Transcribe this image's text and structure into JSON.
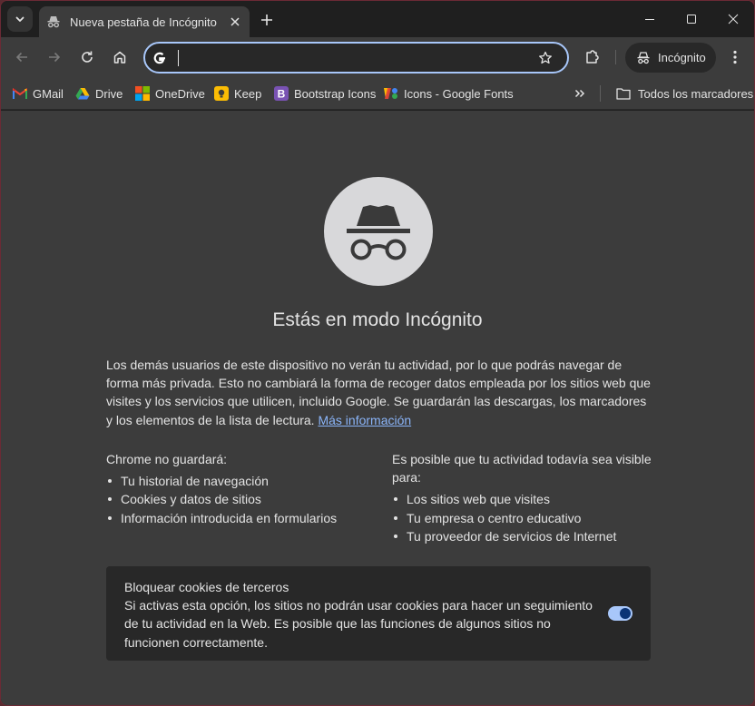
{
  "tabs": [
    {
      "title": "Nueva pestaña de Incógnito",
      "icon": "incognito-icon",
      "active": true
    }
  ],
  "toolbar": {
    "omnibox": {
      "value": "",
      "placeholder": "",
      "icon": "google-g-icon"
    },
    "incognito_chip_label": "Incógnito"
  },
  "bookmarks": {
    "items": [
      {
        "label": "GMail",
        "icon": "gmail-icon"
      },
      {
        "label": "Drive",
        "icon": "google-drive-icon"
      },
      {
        "label": "OneDrive",
        "icon": "microsoft-logo-icon"
      },
      {
        "label": "Keep",
        "icon": "google-keep-icon"
      },
      {
        "label": "Bootstrap Icons",
        "icon": "bootstrap-icon"
      },
      {
        "label": "Icons - Google Fonts",
        "icon": "google-fonts-icon"
      }
    ],
    "overflow_icon": "double-chevron-right-icon",
    "all_bookmarks_label": "Todos los marcadores"
  },
  "page": {
    "headline": "Estás en modo Incógnito",
    "intro": "Los demás usuarios de este dispositivo no verán tu actividad, por lo que podrás navegar de forma más privada. Esto no cambiará la forma de recoger datos empleada por los sitios web que visites y los servicios que utilicen, incluido Google. Se guardarán las descargas, los marcadores y los elementos de la lista de lectura.",
    "learn_more": "Más información",
    "left_column": {
      "heading": "Chrome no guardará:",
      "items": [
        "Tu historial de navegación",
        "Cookies y datos de sitios",
        "Información introducida en formularios"
      ]
    },
    "right_column": {
      "heading": "Es posible que tu actividad todavía sea visible para:",
      "items": [
        "Los sitios web que visites",
        "Tu empresa o centro educativo",
        "Tu proveedor de servicios de Internet"
      ]
    },
    "cookie_card": {
      "title": "Bloquear cookies de terceros",
      "description": "Si activas esta opción, los sitios no podrán usar cookies para hacer un seguimiento de tu actividad en la Web. Es posible que las funciones de algunos sitios no funcionen correctamente.",
      "toggle_on": true
    }
  },
  "colors": {
    "accent": "#a8c7fa",
    "link": "#8ab4f8",
    "toggle_knob": "#0b3476"
  }
}
